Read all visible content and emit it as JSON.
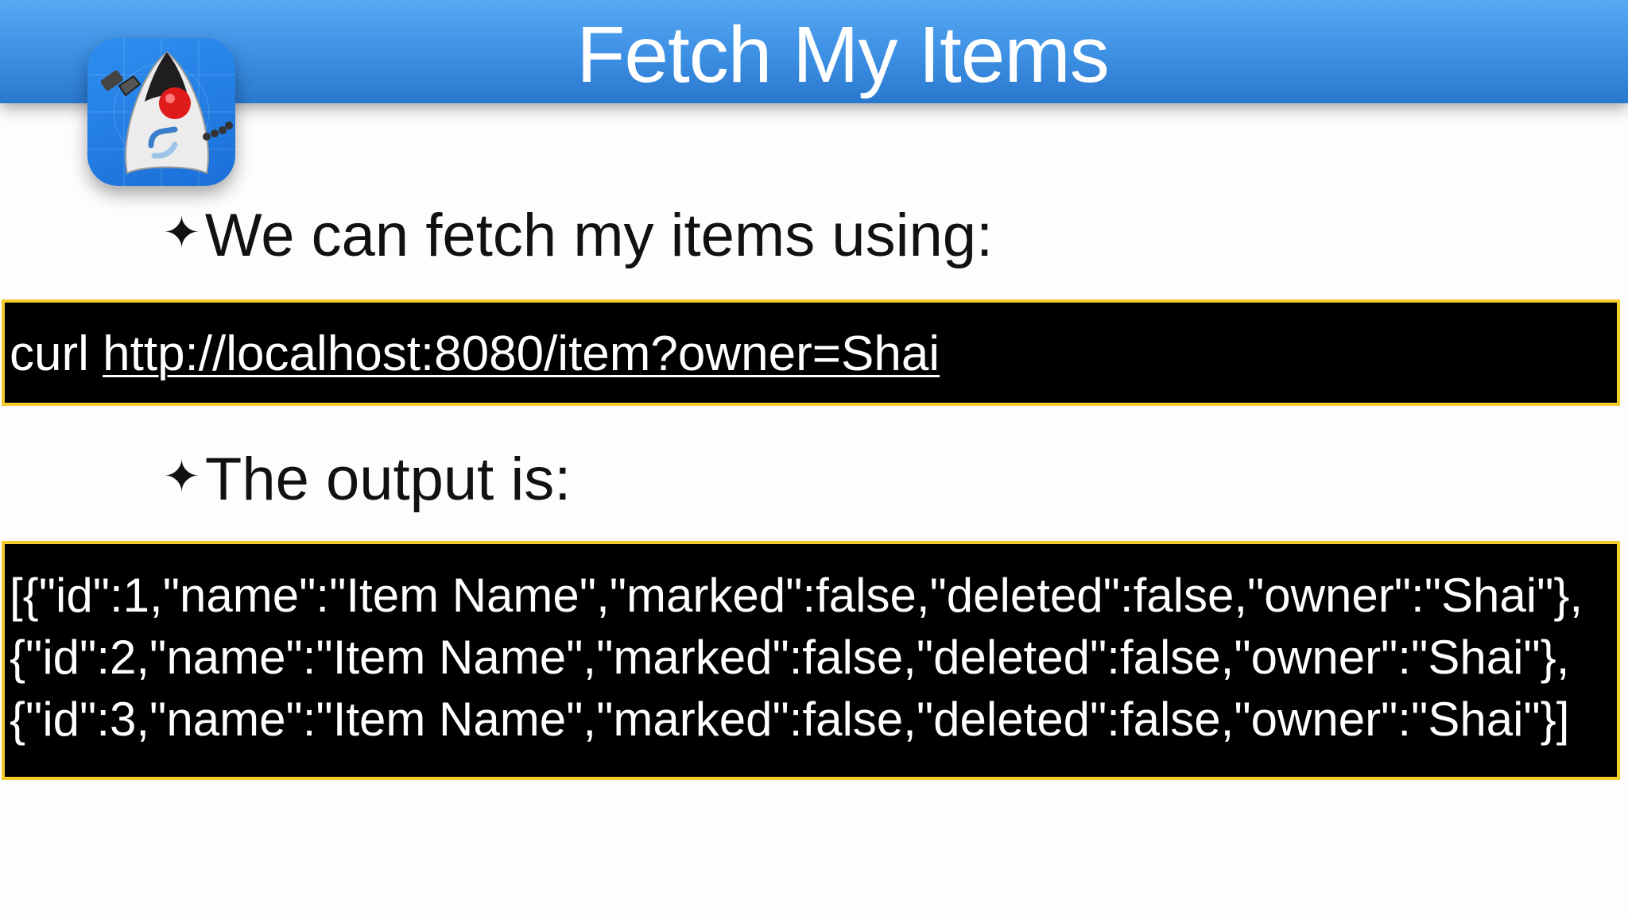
{
  "slide": {
    "title": "Fetch My Items"
  },
  "logo": {
    "icon": "duke-mascot-app-icon",
    "colors": {
      "background": "#2e8ff0",
      "nose": "#e01b1b",
      "head": "#1e1e1e"
    }
  },
  "bullets": [
    {
      "icon": "four-pointed-star-icon",
      "text": "We can fetch my items using:"
    },
    {
      "icon": "four-pointed-star-icon",
      "text": "The output is:"
    }
  ],
  "command": {
    "prefix": "curl ",
    "url": "http://localhost:8080/item?owner=Shai"
  },
  "output": {
    "lines": [
      "[{\"id\":1,\"name\":\"Item Name\",\"marked\":false,\"deleted\":false,\"owner\":\"Shai\"},",
      "{\"id\":2,\"name\":\"Item Name\",\"marked\":false,\"deleted\":false,\"owner\":\"Shai\"},",
      "{\"id\":3,\"name\":\"Item Name\",\"marked\":false,\"deleted\":false,\"owner\":\"Shai\"}]"
    ]
  },
  "theme": {
    "header_blue": "#3c8fe3",
    "code_background": "#000000",
    "code_border": "#f2cc2b",
    "text_color": "#111111"
  }
}
